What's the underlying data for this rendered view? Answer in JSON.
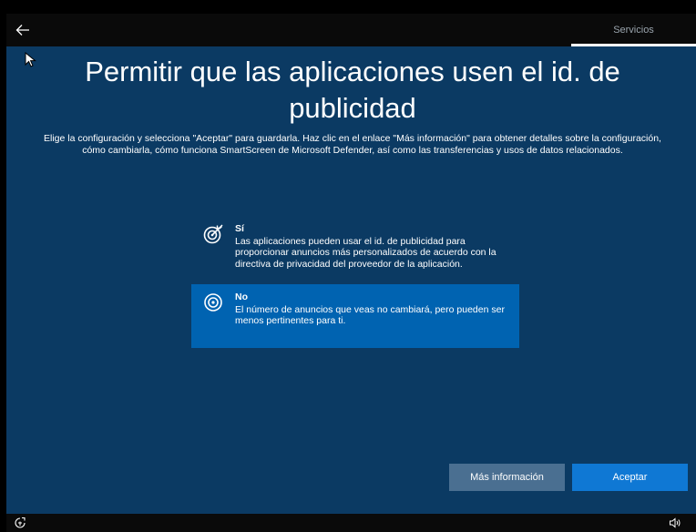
{
  "header": {
    "tab_label": "Servicios"
  },
  "main": {
    "title": "Permitir que las aplicaciones usen el id. de publicidad",
    "description": "Elige la configuración y selecciona \"Aceptar\" para guardarla. Haz clic en el enlace \"Más información\" para obtener detalles sobre la configuración, cómo cambiarla, cómo funciona SmartScreen de Microsoft Defender, así como las transferencias y usos de datos relacionados."
  },
  "options": [
    {
      "title": "Sí",
      "text": "Las aplicaciones pueden usar el id. de publicidad para proporcionar anuncios más personalizados de acuerdo con la directiva de privacidad del proveedor de la aplicación.",
      "icon": "target-check-icon",
      "selected": false
    },
    {
      "title": "No",
      "text": "El número de anuncios que veas no cambiará, pero pueden ser menos pertinentes para ti.",
      "icon": "target-icon",
      "selected": true
    }
  ],
  "buttons": {
    "more_info": "Más información",
    "accept": "Aceptar"
  },
  "colors": {
    "background": "#0b3a63",
    "selected_option": "#0063b1",
    "accept_button": "#0f78d4",
    "secondary_button": "#4a6f91",
    "bars": "#0a0a0a"
  },
  "icons": {
    "back": "back-arrow-icon",
    "accessibility": "accessibility-icon",
    "volume": "volume-icon"
  }
}
